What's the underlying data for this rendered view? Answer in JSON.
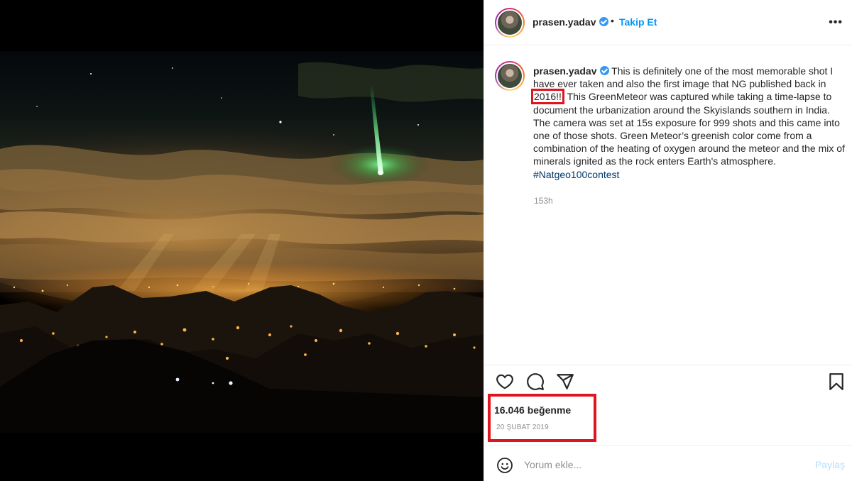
{
  "post": {
    "image_alt": "Green meteor streaking across a cloudy night sky above city lights and dark hills",
    "header": {
      "username": "prasen.yadav",
      "separator": "•",
      "follow_label": "Takip Et",
      "more_label": "•••"
    },
    "caption": {
      "username": "prasen.yadav",
      "text_before": "This is definitely one of the most memorable shot I have ever taken and also the first image that NG published back in ",
      "highlighted": "2016!!",
      "text_after": " This GreenMeteor was captured while taking a time-lapse to document the urbanization around the Skyislands southern in India. The camera was set at 15s exposure for 999 shots and this came into one of those shots. Green Meteor’s greenish color come from a combination of the heating of oxygen around the meteor and the mix of minerals ignited as the rock enters Earth's atmosphere.",
      "hashtag": "#Natgeo100contest",
      "time_ago": "153h"
    },
    "actions": {
      "like_icon": "heart-icon",
      "comment_icon": "comment-bubble-icon",
      "share_icon": "paper-plane-icon",
      "save_icon": "bookmark-icon"
    },
    "likes": "16.046 beğenme",
    "date": "20 ŞUBAT 2019",
    "comment": {
      "emoji_icon": "smiley-icon",
      "placeholder": "Yorum ekle...",
      "post_label": "Paylaş"
    },
    "colors": {
      "accent": "#0095f6",
      "highlight": "#e0141f",
      "verified": "#3897f0",
      "muted": "#8e8e8e"
    }
  }
}
